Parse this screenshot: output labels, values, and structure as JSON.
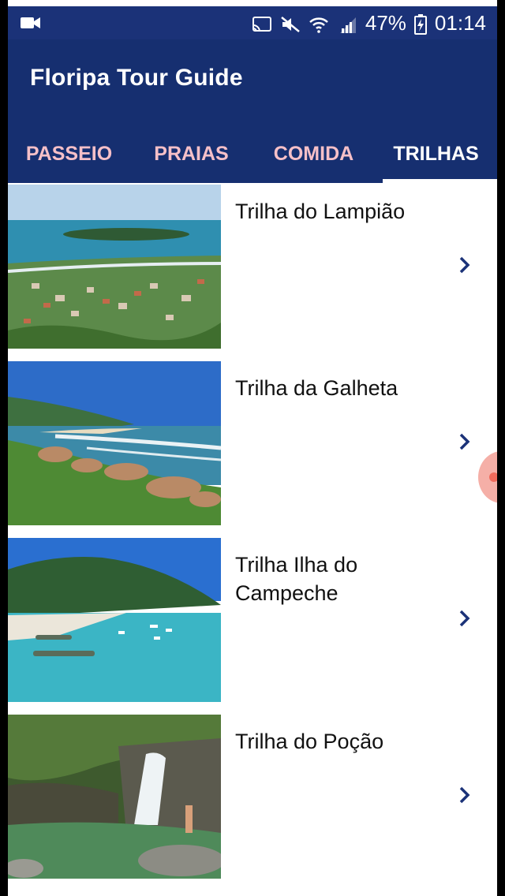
{
  "status_bar": {
    "battery": "47%",
    "time": "01:14",
    "icons": [
      "video-icon",
      "cast-icon",
      "mute-icon",
      "wifi-icon",
      "signal-icon",
      "battery-charging-icon"
    ]
  },
  "app": {
    "title": "Floripa Tour Guide",
    "accent": "#162f70",
    "tab_inactive_color": "#f6c0c8"
  },
  "tabs": [
    {
      "label": "PASSEIO",
      "active": false
    },
    {
      "label": "PRAIAS",
      "active": false
    },
    {
      "label": "COMIDA",
      "active": false
    },
    {
      "label": "TRILHAS",
      "active": true
    }
  ],
  "items": [
    {
      "title": "Trilha do Lampião",
      "image": "coastal-town-island-photo",
      "icon": "chevron-right-icon"
    },
    {
      "title": "Trilha da Galheta",
      "image": "beach-rocks-photo",
      "icon": "chevron-right-icon"
    },
    {
      "title": "Trilha Ilha do Campeche",
      "image": "island-boats-photo",
      "icon": "chevron-right-icon"
    },
    {
      "title": "Trilha do Poção",
      "image": "waterfall-pool-photo",
      "icon": "chevron-right-icon"
    }
  ]
}
